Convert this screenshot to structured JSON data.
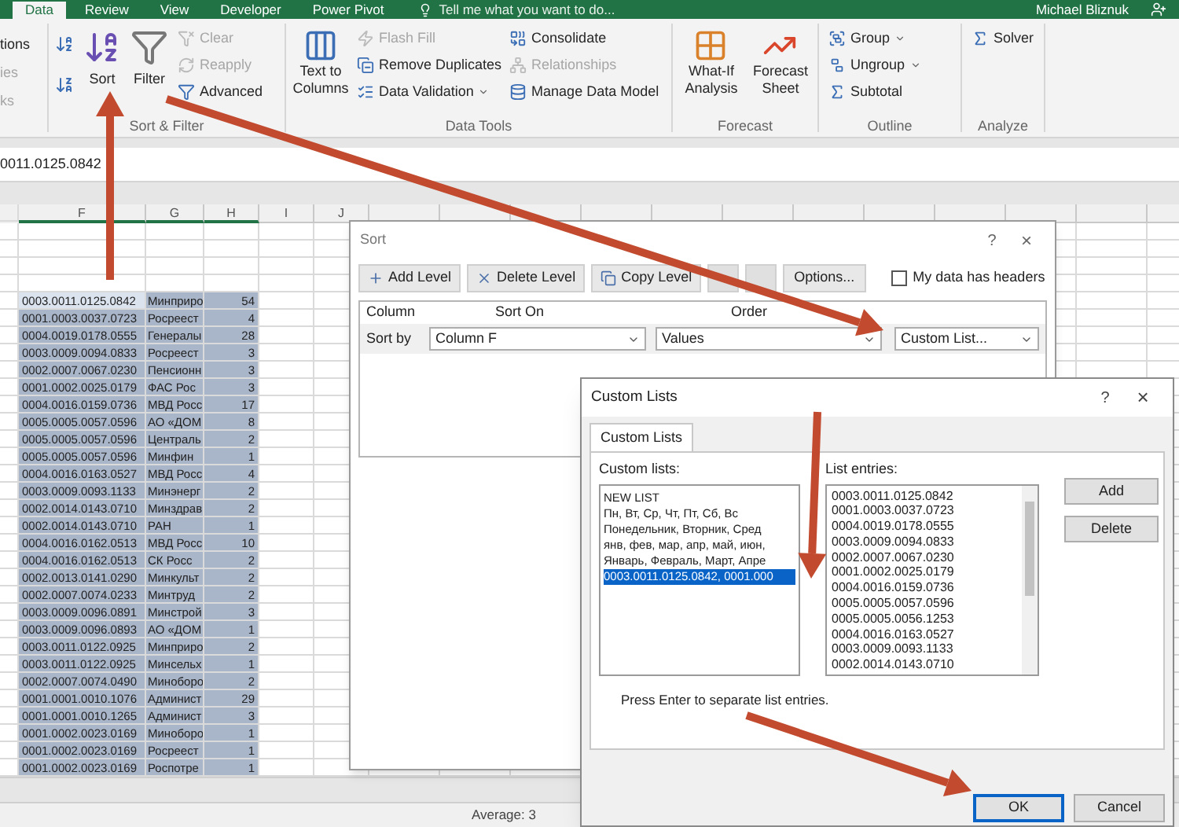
{
  "ribbon_tabs": [
    {
      "label": "Data",
      "selected": true
    },
    {
      "label": "Review",
      "selected": false
    },
    {
      "label": "View",
      "selected": false
    },
    {
      "label": "Developer",
      "selected": false
    },
    {
      "label": "Power Pivot",
      "selected": false
    }
  ],
  "tell_me": {
    "placeholder": "Tell me what you want to do..."
  },
  "user_name": "Michael Bliznuk",
  "ribbon": {
    "cut_group": [
      {
        "label": "tions",
        "disabled": false
      },
      {
        "label": "ies",
        "disabled": true
      },
      {
        "label": "ks",
        "disabled": true
      }
    ],
    "sort_filter": {
      "label": "Sort & Filter",
      "sort": "Sort",
      "filter": "Filter",
      "small": [
        {
          "label": "Clear",
          "disabled": true
        },
        {
          "label": "Reapply",
          "disabled": true
        },
        {
          "label": "Advanced",
          "disabled": false
        }
      ]
    },
    "data_tools": {
      "label": "Data Tools",
      "text_to_columns": "Text to Columns",
      "col1": [
        {
          "label": "Flash Fill",
          "disabled": true,
          "dropdown": false
        },
        {
          "label": "Remove Duplicates",
          "disabled": false,
          "dropdown": false
        },
        {
          "label": "Data Validation",
          "disabled": false,
          "dropdown": true
        }
      ],
      "col2": [
        {
          "label": "Consolidate",
          "disabled": false
        },
        {
          "label": "Relationships",
          "disabled": true
        },
        {
          "label": "Manage Data Model",
          "disabled": false
        }
      ]
    },
    "forecast": {
      "label": "Forecast",
      "what_if": "What-If Analysis",
      "forecast_sheet": "Forecast Sheet"
    },
    "outline": {
      "label": "Outline",
      "items": [
        {
          "label": "Group",
          "dropdown": true
        },
        {
          "label": "Ungroup",
          "dropdown": true
        },
        {
          "label": "Subtotal",
          "dropdown": false
        }
      ]
    },
    "analyze": {
      "label": "Analyze",
      "solver": "Solver"
    }
  },
  "formula_bar": {
    "value": "0011.0125.0842"
  },
  "sheet": {
    "columns": [
      "F",
      "G",
      "H",
      "I",
      "J"
    ],
    "rows": [
      {
        "code": "0003.0011.0125.0842",
        "org": "Минприро",
        "count": "54",
        "selected": true,
        "active": true
      },
      {
        "code": "0001.0003.0037.0723",
        "org": "Росреест",
        "count": "4",
        "selected": true,
        "active": false
      },
      {
        "code": "0004.0019.0178.0555",
        "org": "Генералы",
        "count": "28",
        "selected": true,
        "active": false
      },
      {
        "code": "0003.0009.0094.0833",
        "org": "Росреест",
        "count": "3",
        "selected": true,
        "active": false
      },
      {
        "code": "0002.0007.0067.0230",
        "org": "Пенсионн",
        "count": "3",
        "selected": true,
        "active": false
      },
      {
        "code": "0001.0002.0025.0179",
        "org": "ФАС Рос",
        "count": "3",
        "selected": true,
        "active": false
      },
      {
        "code": "0004.0016.0159.0736",
        "org": "МВД Росс",
        "count": "17",
        "selected": true,
        "active": false
      },
      {
        "code": "0005.0005.0057.0596",
        "org": "АО «ДОМ",
        "count": "8",
        "selected": true,
        "active": false
      },
      {
        "code": "0005.0005.0057.0596",
        "org": "Централь",
        "count": "2",
        "selected": true,
        "active": false
      },
      {
        "code": "0005.0005.0057.0596",
        "org": "Минфин",
        "count": "1",
        "selected": true,
        "active": false
      },
      {
        "code": "0004.0016.0163.0527",
        "org": "МВД Росс",
        "count": "4",
        "selected": true,
        "active": false
      },
      {
        "code": "0003.0009.0093.1133",
        "org": "Минэнерг",
        "count": "2",
        "selected": true,
        "active": false
      },
      {
        "code": "0002.0014.0143.0710",
        "org": "Минздрав",
        "count": "2",
        "selected": true,
        "active": false
      },
      {
        "code": "0002.0014.0143.0710",
        "org": "РАН",
        "count": "1",
        "selected": true,
        "active": false
      },
      {
        "code": "0004.0016.0162.0513",
        "org": "МВД Росс",
        "count": "10",
        "selected": true,
        "active": false
      },
      {
        "code": "0004.0016.0162.0513",
        "org": "СК Росс",
        "count": "2",
        "selected": true,
        "active": false
      },
      {
        "code": "0002.0013.0141.0290",
        "org": "Минкульт",
        "count": "2",
        "selected": true,
        "active": false
      },
      {
        "code": "0002.0007.0074.0233",
        "org": "Минтруд",
        "count": "2",
        "selected": true,
        "active": false
      },
      {
        "code": "0003.0009.0096.0891",
        "org": "Минстрой",
        "count": "3",
        "selected": true,
        "active": false
      },
      {
        "code": "0003.0009.0096.0893",
        "org": "АО «ДОМ",
        "count": "1",
        "selected": true,
        "active": false
      },
      {
        "code": "0003.0011.0122.0925",
        "org": "Минприро",
        "count": "2",
        "selected": true,
        "active": false
      },
      {
        "code": "0003.0011.0122.0925",
        "org": "Минсельх",
        "count": "1",
        "selected": true,
        "active": false
      },
      {
        "code": "0002.0007.0074.0490",
        "org": "Миноборо",
        "count": "2",
        "selected": true,
        "active": false
      },
      {
        "code": "0001.0001.0010.1076",
        "org": "Админист",
        "count": "29",
        "selected": true,
        "active": false
      },
      {
        "code": "0001.0001.0010.1265",
        "org": "Админист",
        "count": "3",
        "selected": true,
        "active": false
      },
      {
        "code": "0001.0002.0023.0169",
        "org": "Миноборо",
        "count": "1",
        "selected": true,
        "active": false
      },
      {
        "code": "0001.0002.0023.0169",
        "org": "Росреест",
        "count": "1",
        "selected": true,
        "active": false
      },
      {
        "code": "0001.0002.0023.0169",
        "org": "Роспотре",
        "count": "1",
        "selected": true,
        "active": false
      }
    ]
  },
  "status_bar": {
    "average": "Average: 3"
  },
  "sort_dialog": {
    "title": "Sort",
    "help_glyph": "?",
    "close_glyph": "×",
    "toolbar": [
      {
        "kind": "add",
        "label": "Add Level"
      },
      {
        "kind": "delete",
        "label": "Delete Level"
      },
      {
        "kind": "copy",
        "label": "Copy Level"
      }
    ],
    "move_buttons": [
      {
        "disabled": true
      },
      {
        "disabled": true
      }
    ],
    "options": "Options...",
    "headers_checkbox": {
      "label": "My data has headers",
      "checked": false
    },
    "headers": [
      "Column",
      "Sort On",
      "Order"
    ],
    "row": {
      "label": "Sort by",
      "column": "Column F",
      "sort_on": "Values",
      "order": "Custom List..."
    }
  },
  "custom_lists_dialog": {
    "title": "Custom Lists",
    "help_glyph": "?",
    "close_glyph": "×",
    "tab": {
      "label": "Custom Lists",
      "selected": true
    },
    "lists_label": "Custom lists:",
    "lists": [
      {
        "label": "NEW LIST",
        "selected": false
      },
      {
        "label": "Пн, Вт, Ср, Чт, Пт, Сб, Вс",
        "selected": false
      },
      {
        "label": "Понедельник, Вторник, Сред",
        "selected": false
      },
      {
        "label": "янв, фев, мар, апр, май, июн,",
        "selected": false
      },
      {
        "label": "Январь, Февраль, Март, Апре",
        "selected": false
      },
      {
        "label": "0003.0011.0125.0842, 0001.000",
        "selected": true
      }
    ],
    "entries_label": "List entries:",
    "entries": [
      "0003.0011.0125.0842",
      "0001.0003.0037.0723",
      "0004.0019.0178.0555",
      "0003.0009.0094.0833",
      "0002.0007.0067.0230",
      "0001.0002.0025.0179",
      "0004.0016.0159.0736",
      "0005.0005.0057.0596",
      "0005.0005.0056.1253",
      "0004.0016.0163.0527",
      "0003.0009.0093.1133",
      "0002.0014.0143.0710"
    ],
    "side_buttons": [
      "Add",
      "Delete"
    ],
    "hint": "Press Enter to separate list entries.",
    "footer_buttons": [
      {
        "label": "OK",
        "default": true
      },
      {
        "label": "Cancel",
        "default": false
      }
    ]
  }
}
